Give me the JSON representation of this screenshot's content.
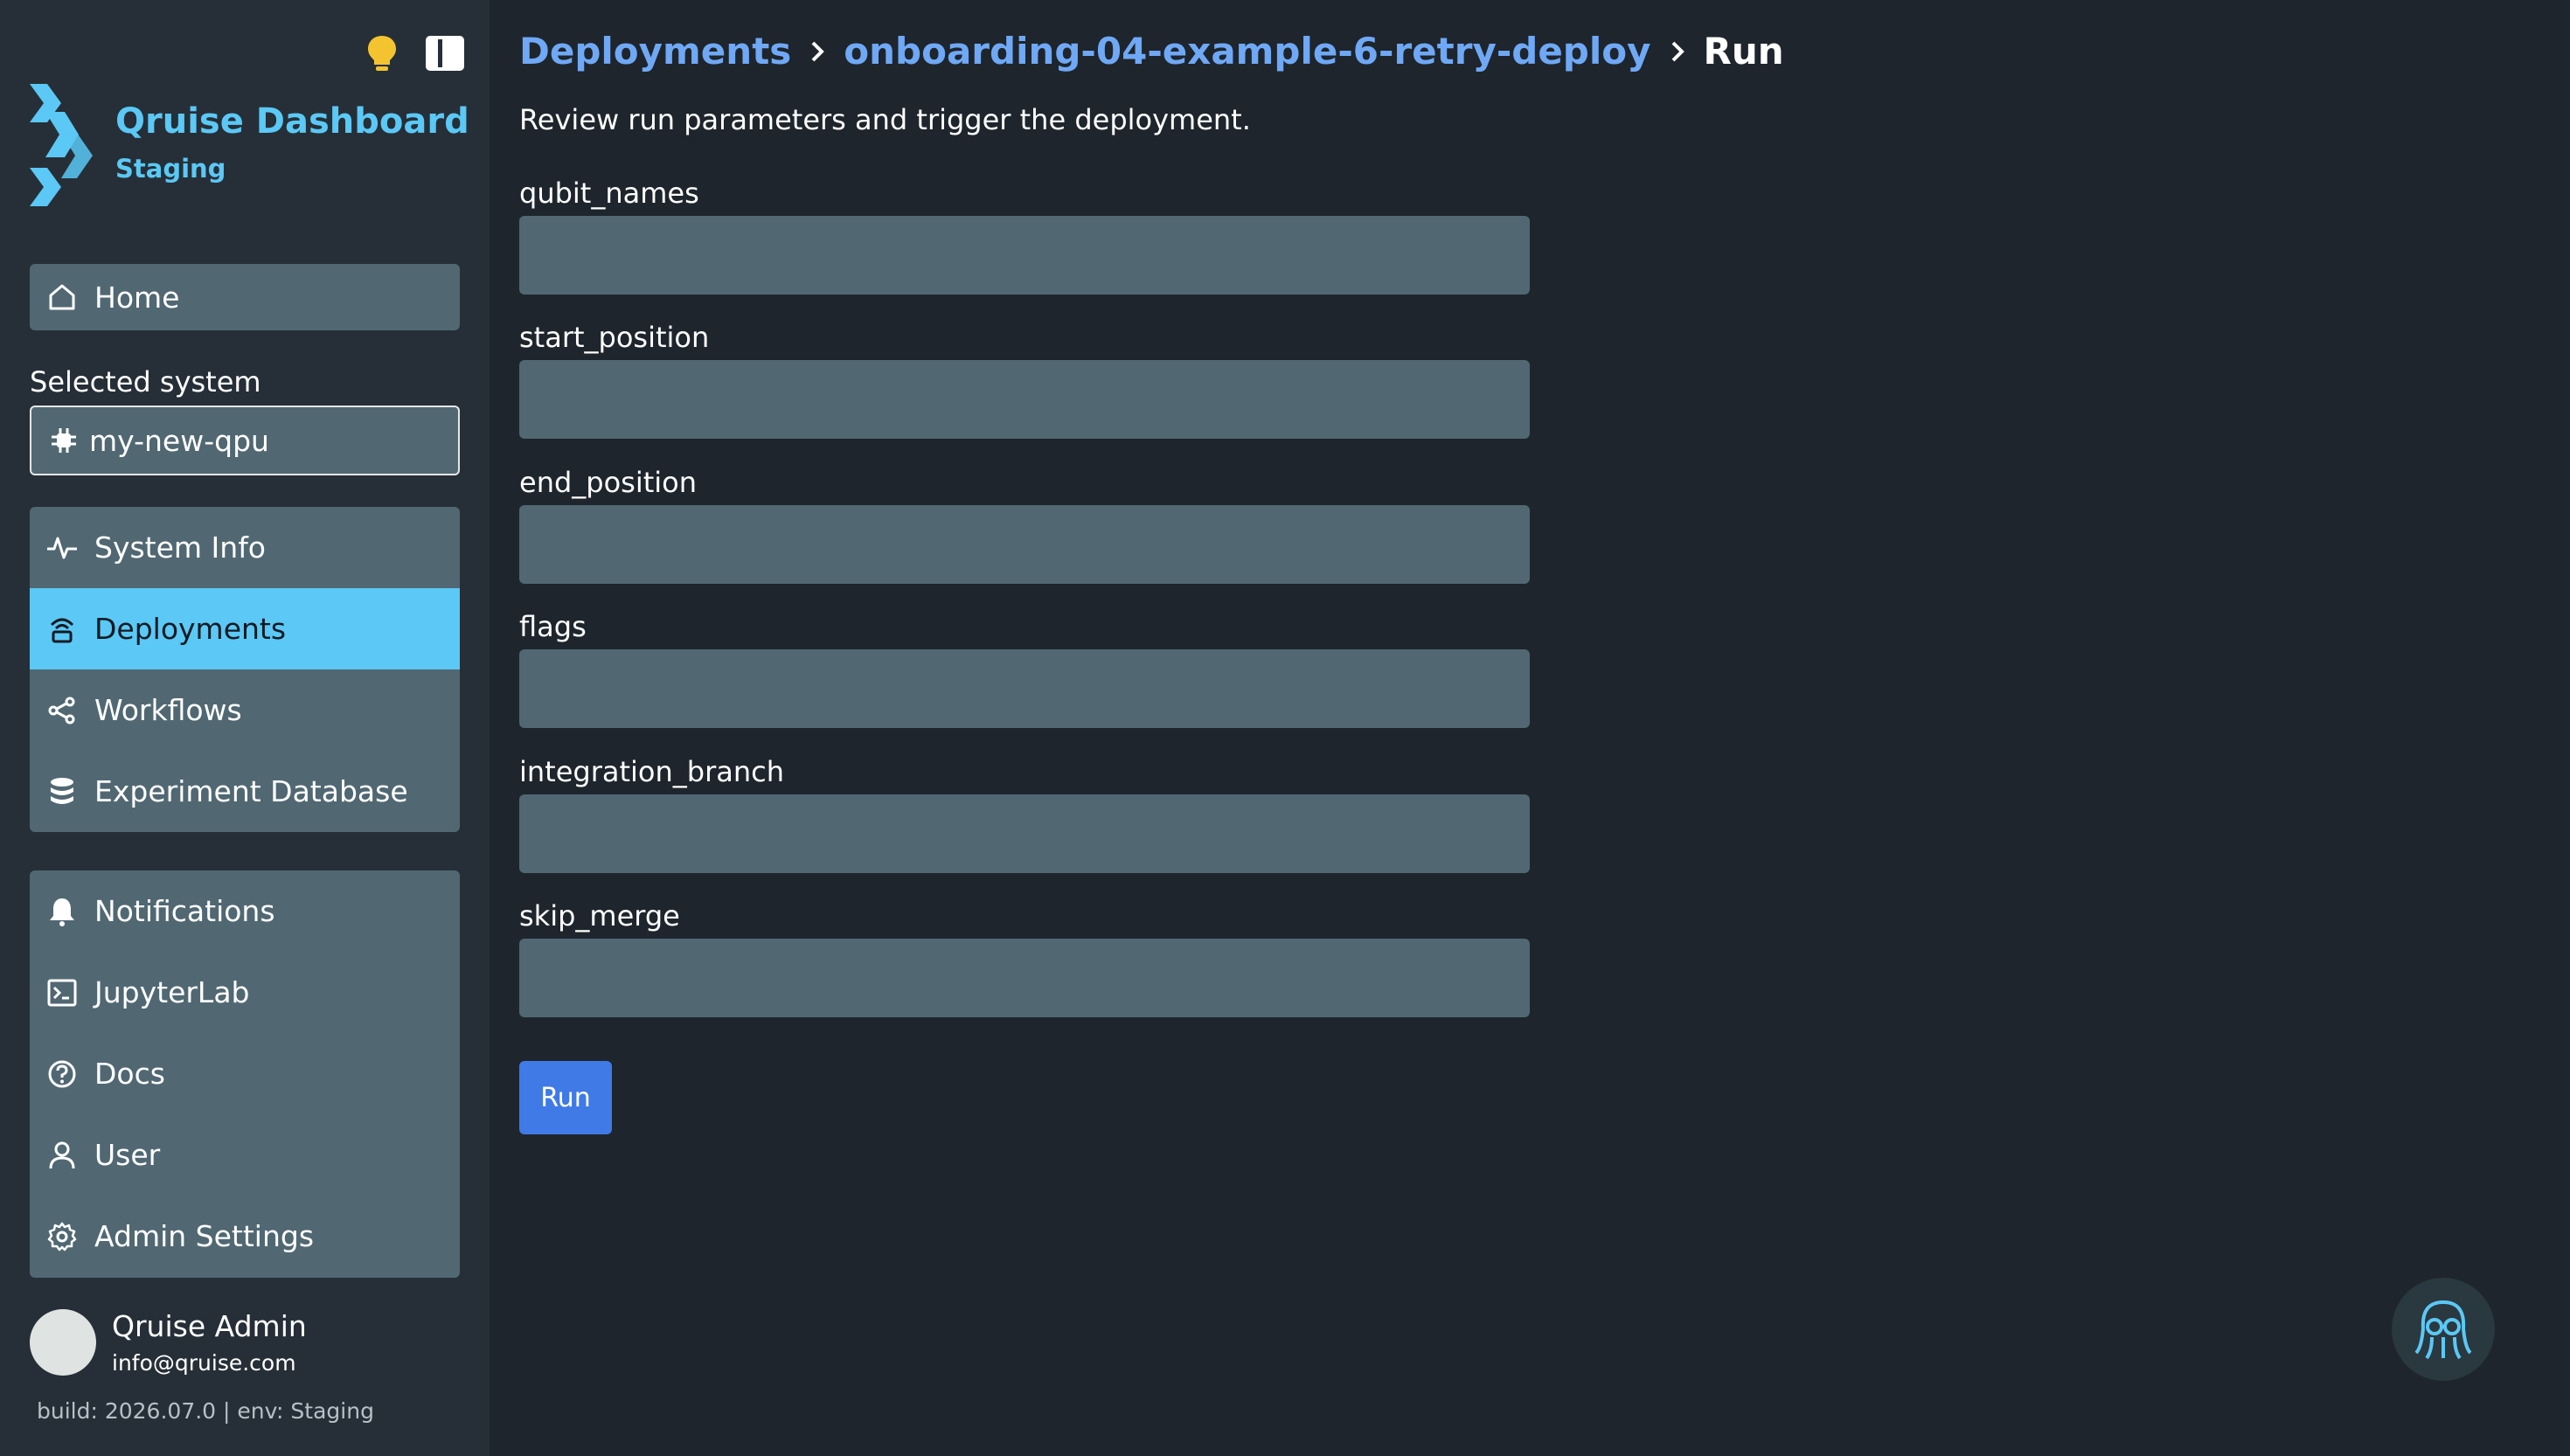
{
  "app": {
    "title": "Qruise Dashboard",
    "environment": "Staging"
  },
  "sidebar": {
    "home_label": "Home",
    "selected_system_label": "Selected system",
    "selected_system_value": "my-new-qpu",
    "system_nav": [
      {
        "label": "System Info",
        "icon": "pulse-icon",
        "active": false
      },
      {
        "label": "Deployments",
        "icon": "deployment-icon",
        "active": true
      },
      {
        "label": "Workflows",
        "icon": "workflow-icon",
        "active": false
      },
      {
        "label": "Experiment Database",
        "icon": "database-icon",
        "active": false
      }
    ],
    "misc_nav": [
      {
        "label": "Notifications",
        "icon": "bell-icon"
      },
      {
        "label": "JupyterLab",
        "icon": "terminal-icon"
      },
      {
        "label": "Docs",
        "icon": "help-icon"
      },
      {
        "label": "User",
        "icon": "user-icon"
      },
      {
        "label": "Admin Settings",
        "icon": "gear-icon"
      }
    ],
    "user": {
      "name": "Qruise Admin",
      "email": "info@qruise.com"
    },
    "build_info": "build: 2026.07.0 | env: Staging"
  },
  "breadcrumb": {
    "root": "Deployments",
    "deployment": "onboarding-04-example-6-retry-deploy",
    "current": "Run"
  },
  "main": {
    "subtitle": "Review run parameters and trigger the deployment.",
    "fields": [
      {
        "label": "qubit_names",
        "value": ""
      },
      {
        "label": "start_position",
        "value": ""
      },
      {
        "label": "end_position",
        "value": ""
      },
      {
        "label": "flags",
        "value": ""
      },
      {
        "label": "integration_branch",
        "value": ""
      },
      {
        "label": "skip_merge",
        "value": ""
      }
    ],
    "run_label": "Run"
  },
  "colors": {
    "accent": "#5bc8f5",
    "link": "#6fa8f5",
    "primary_button": "#3f7ae6",
    "input_bg": "#516873",
    "bulb": "#f4c430"
  }
}
